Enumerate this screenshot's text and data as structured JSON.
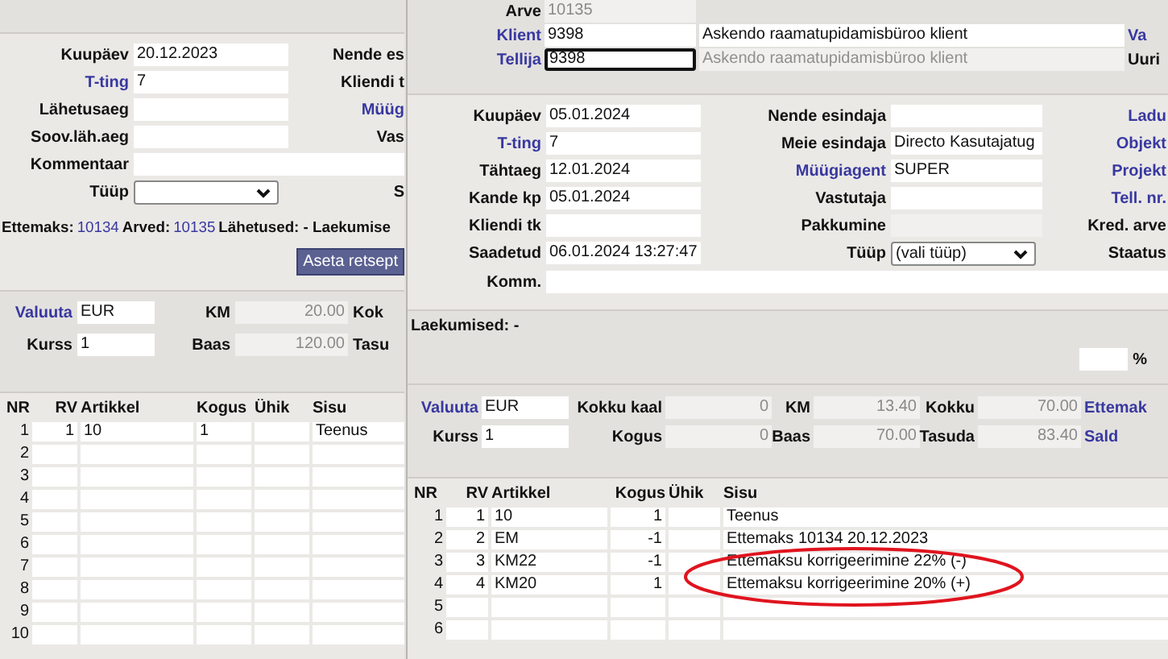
{
  "back_window": {
    "form": [
      {
        "label": "Kuupäev",
        "link": false,
        "kind": "input",
        "value": "20.12.2023",
        "side_label": "Nende es",
        "side_link": false
      },
      {
        "label": "T-ting",
        "link": true,
        "kind": "input",
        "value": "7",
        "side_label": "Kliendi t",
        "side_link": false
      },
      {
        "label": "Lähetusaeg",
        "link": false,
        "kind": "input",
        "side_label": "Müüg",
        "side_link": true
      },
      {
        "label": "Soov.läh.aeg",
        "link": false,
        "kind": "input",
        "side_label": "Vas",
        "side_link": false
      },
      {
        "label": "Kommentaar",
        "link": false,
        "kind": "wide"
      },
      {
        "label": "Tüüp",
        "link": false,
        "kind": "select",
        "side_label": "S",
        "side_link": false
      }
    ],
    "info_line": [
      {
        "text": "Ettemaks:",
        "link": false
      },
      {
        "text": "10134",
        "link": true
      },
      {
        "text": "Arved:",
        "link": false
      },
      {
        "text": "10135",
        "link": true
      },
      {
        "text": "Lähetused: - Laekumise",
        "link": false
      }
    ],
    "button": "Aseta retsept",
    "totals": [
      [
        {
          "label": "Valuuta",
          "link": true,
          "kind": "input",
          "value": "EUR"
        },
        {
          "label": "KM",
          "link": false,
          "kind": "readonly",
          "value": "20.00"
        },
        {
          "label": "Kok",
          "link": false,
          "kind": "label"
        }
      ],
      [
        {
          "label": "Kurss",
          "link": false,
          "kind": "input",
          "value": "1"
        },
        {
          "label": "Baas",
          "link": false,
          "kind": "readonly",
          "value": "120.00"
        },
        {
          "label": "Tasu",
          "link": false,
          "kind": "label"
        }
      ]
    ],
    "table": {
      "columns": [
        "NR",
        "RV",
        "Artikkel",
        "Kogus",
        "Ühik",
        "Sisu"
      ],
      "rows": [
        {
          "nr": "1",
          "rv": "1",
          "artikkel": "10",
          "kogus": "1",
          "sisu": "Teenus"
        },
        {
          "nr": "2"
        },
        {
          "nr": "3"
        },
        {
          "nr": "4"
        },
        {
          "nr": "5"
        },
        {
          "nr": "6"
        },
        {
          "nr": "7"
        },
        {
          "nr": "8"
        },
        {
          "nr": "9"
        },
        {
          "nr": "10"
        }
      ]
    }
  },
  "front_window": {
    "header": [
      {
        "label": "Arve",
        "link": false,
        "kind": "readonly",
        "value": "10135",
        "focused": false
      },
      {
        "label": "Klient",
        "link": true,
        "kind": "input",
        "value": "9398",
        "focused": false,
        "name": "Askendo raamatupidamisbüroo klient",
        "name_disabled": false,
        "side_label": "Va",
        "side_link": true
      },
      {
        "label": "Tellija",
        "link": true,
        "kind": "input",
        "value": "9398",
        "focused": true,
        "name": "Askendo raamatupidamisbüroo klient",
        "name_disabled": true,
        "side_label": "Uuri",
        "side_link": false
      }
    ],
    "form": [
      [
        {
          "label": "Kuupäev",
          "link": false,
          "kind": "input",
          "value": "05.01.2024"
        },
        {
          "label": "Nende esindaja",
          "link": false,
          "kind": "input"
        },
        {
          "label": "Ladu",
          "link": true,
          "kind": "label"
        }
      ],
      [
        {
          "label": "T-ting",
          "link": true,
          "kind": "input",
          "value": "7"
        },
        {
          "label": "Meie esindaja",
          "link": false,
          "kind": "input",
          "value": "Directo Kasutajatug"
        },
        {
          "label": "Objekt",
          "link": true,
          "kind": "label"
        }
      ],
      [
        {
          "label": "Tähtaeg",
          "link": false,
          "kind": "input",
          "value": "12.01.2024"
        },
        {
          "label": "Müügiagent",
          "link": true,
          "kind": "input",
          "value": "SUPER"
        },
        {
          "label": "Projekt",
          "link": true,
          "kind": "label"
        }
      ],
      [
        {
          "label": "Kande kp",
          "link": false,
          "kind": "input",
          "value": "05.01.2024"
        },
        {
          "label": "Vastutaja",
          "link": false,
          "kind": "input"
        },
        {
          "label": "Tell. nr.",
          "link": true,
          "kind": "label"
        }
      ],
      [
        {
          "label": "Kliendi tk",
          "link": false,
          "kind": "input"
        },
        {
          "label": "Pakkumine",
          "link": false,
          "kind": "readonly"
        },
        {
          "label": "Kred. arve",
          "link": false,
          "kind": "label"
        }
      ],
      [
        {
          "label": "Saadetud",
          "link": false,
          "kind": "input",
          "value": "06.01.2024 13:27:47"
        },
        {
          "label": "Tüüp",
          "link": false,
          "kind": "select",
          "value": "(vali tüüp)"
        },
        {
          "label": "Staatus",
          "link": false,
          "kind": "label"
        }
      ],
      [
        {
          "label": "Komm.",
          "link": false,
          "kind": "wide"
        }
      ]
    ],
    "receipts": "Laekumised: -",
    "percent_label": "%",
    "totals": [
      [
        {
          "label": "Valuuta",
          "link": true,
          "kind": "input",
          "value": "EUR"
        },
        {
          "label": "Kokku kaal",
          "link": false,
          "kind": "readonly",
          "value": "0"
        },
        {
          "label": "KM",
          "link": false,
          "kind": "readonly",
          "value": "13.40"
        },
        {
          "label": "Kokku",
          "link": false,
          "kind": "readonly",
          "value": "70.00"
        },
        {
          "label": "Ettemak",
          "link": true,
          "kind": "label"
        }
      ],
      [
        {
          "label": "Kurss",
          "link": false,
          "kind": "input",
          "value": "1"
        },
        {
          "label": "Kogus",
          "link": false,
          "kind": "readonly",
          "value": "0"
        },
        {
          "label": "Baas",
          "link": false,
          "kind": "readonly",
          "value": "70.00"
        },
        {
          "label": "Tasuda",
          "link": false,
          "kind": "readonly",
          "value": "83.40"
        },
        {
          "label": "Sald",
          "link": true,
          "kind": "label"
        }
      ]
    ],
    "table": {
      "columns": [
        "NR",
        "RV",
        "Artikkel",
        "Kogus",
        "Ühik",
        "Sisu"
      ],
      "rows": [
        {
          "nr": "1",
          "rv": "1",
          "artikkel": "10",
          "kogus": "1",
          "sisu": "Teenus",
          "circled": false
        },
        {
          "nr": "2",
          "rv": "2",
          "artikkel": "EM",
          "kogus": "-1",
          "sisu": "Ettemaks 10134 20.12.2023",
          "circled": false
        },
        {
          "nr": "3",
          "rv": "3",
          "artikkel": "KM22",
          "kogus": "-1",
          "sisu": "Ettemaksu korrigeerimine 22% (-)",
          "circled": true
        },
        {
          "nr": "4",
          "rv": "4",
          "artikkel": "KM20",
          "kogus": "1",
          "sisu": "Ettemaksu korrigeerimine 20% (+)",
          "circled": true
        },
        {
          "nr": "5",
          "circled": false
        },
        {
          "nr": "6",
          "circled": false
        }
      ]
    }
  }
}
